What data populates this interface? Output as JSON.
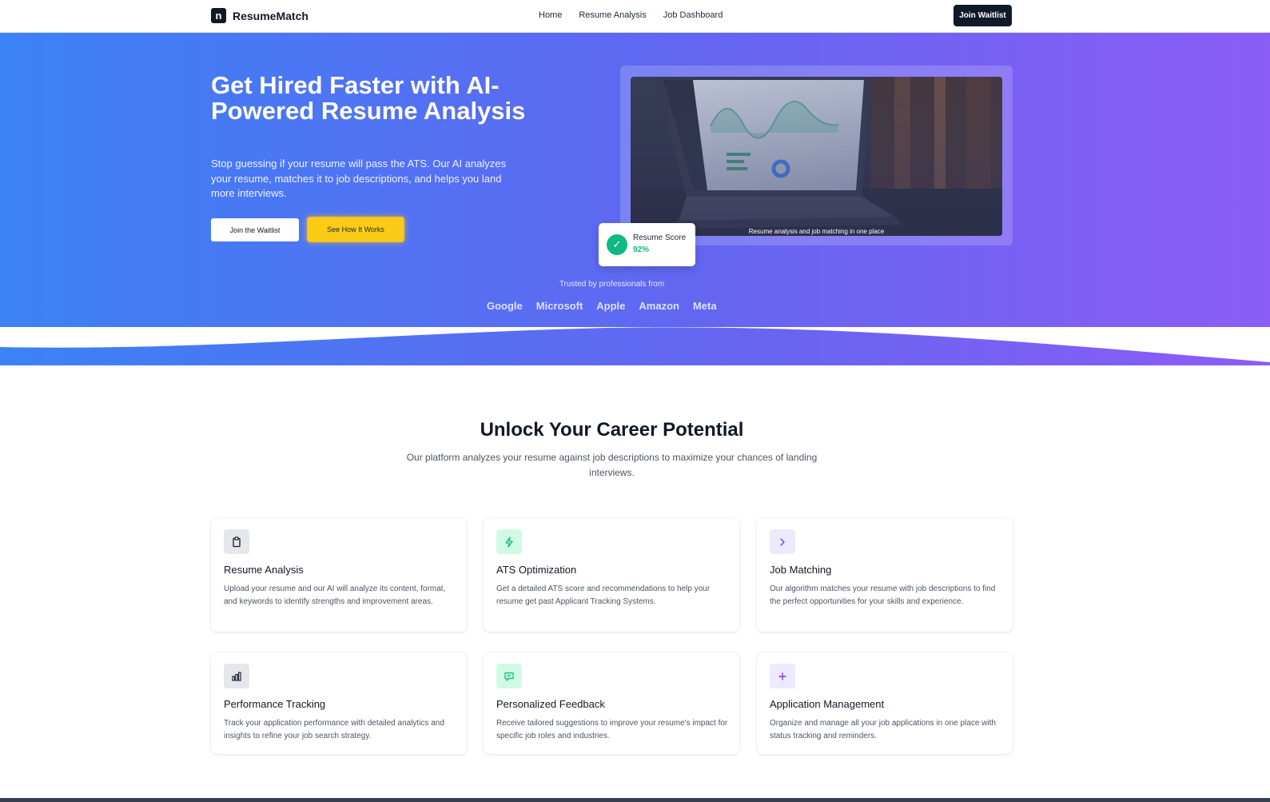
{
  "nav": {
    "brand": "ResumeMatch",
    "brand_mark": "n",
    "links": [
      "Home",
      "Resume Analysis",
      "Job Dashboard"
    ],
    "cta": "Join Waitlist"
  },
  "hero": {
    "headline": "Get Hired Faster with AI-Powered Resume Analysis",
    "subtext": "Stop guessing if your resume will pass the ATS. Our AI analyzes your resume, matches it to job descriptions, and helps you land more interviews.",
    "primary_button": "Join the Waitlist",
    "secondary_button": "See How It Works",
    "image_caption": "Resume analysis and job matching in one place",
    "score": {
      "label": "Resume Score",
      "value": "92%"
    },
    "trusted_text": "Trusted by professionals from",
    "companies": [
      "Google",
      "Microsoft",
      "Apple",
      "Amazon",
      "Meta"
    ],
    "gradient_colors": [
      "#3b82f6",
      "#6366f1",
      "#8b5cf6"
    ]
  },
  "features": {
    "title": "Unlock Your Career Potential",
    "subtitle": "Our platform analyzes your resume against job descriptions to maximize your chances of landing interviews.",
    "cards": [
      {
        "icon": "clipboard-icon",
        "title": "Resume Analysis",
        "description": "Upload your resume and our AI will analyze its content, format, and keywords to identify strengths and improvement areas."
      },
      {
        "icon": "lightning-icon",
        "title": "ATS Optimization",
        "description": "Get a detailed ATS score and recommendations to help your resume get past Applicant Tracking Systems."
      },
      {
        "icon": "chevron-right-icon",
        "title": "Job Matching",
        "description": "Our algorithm matches your resume with job descriptions to find the perfect opportunities for your skills and experience."
      },
      {
        "icon": "bar-chart-icon",
        "title": "Performance Tracking",
        "description": "Track your application performance with detailed analytics and insights to refine your job search strategy."
      },
      {
        "icon": "message-icon",
        "title": "Personalized Feedback",
        "description": "Receive tailored suggestions to improve your resume's impact for specific job roles and industries."
      },
      {
        "icon": "plus-icon",
        "title": "Application Management",
        "description": "Organize and manage all your job applications in one place with status tracking and reminders."
      }
    ]
  }
}
